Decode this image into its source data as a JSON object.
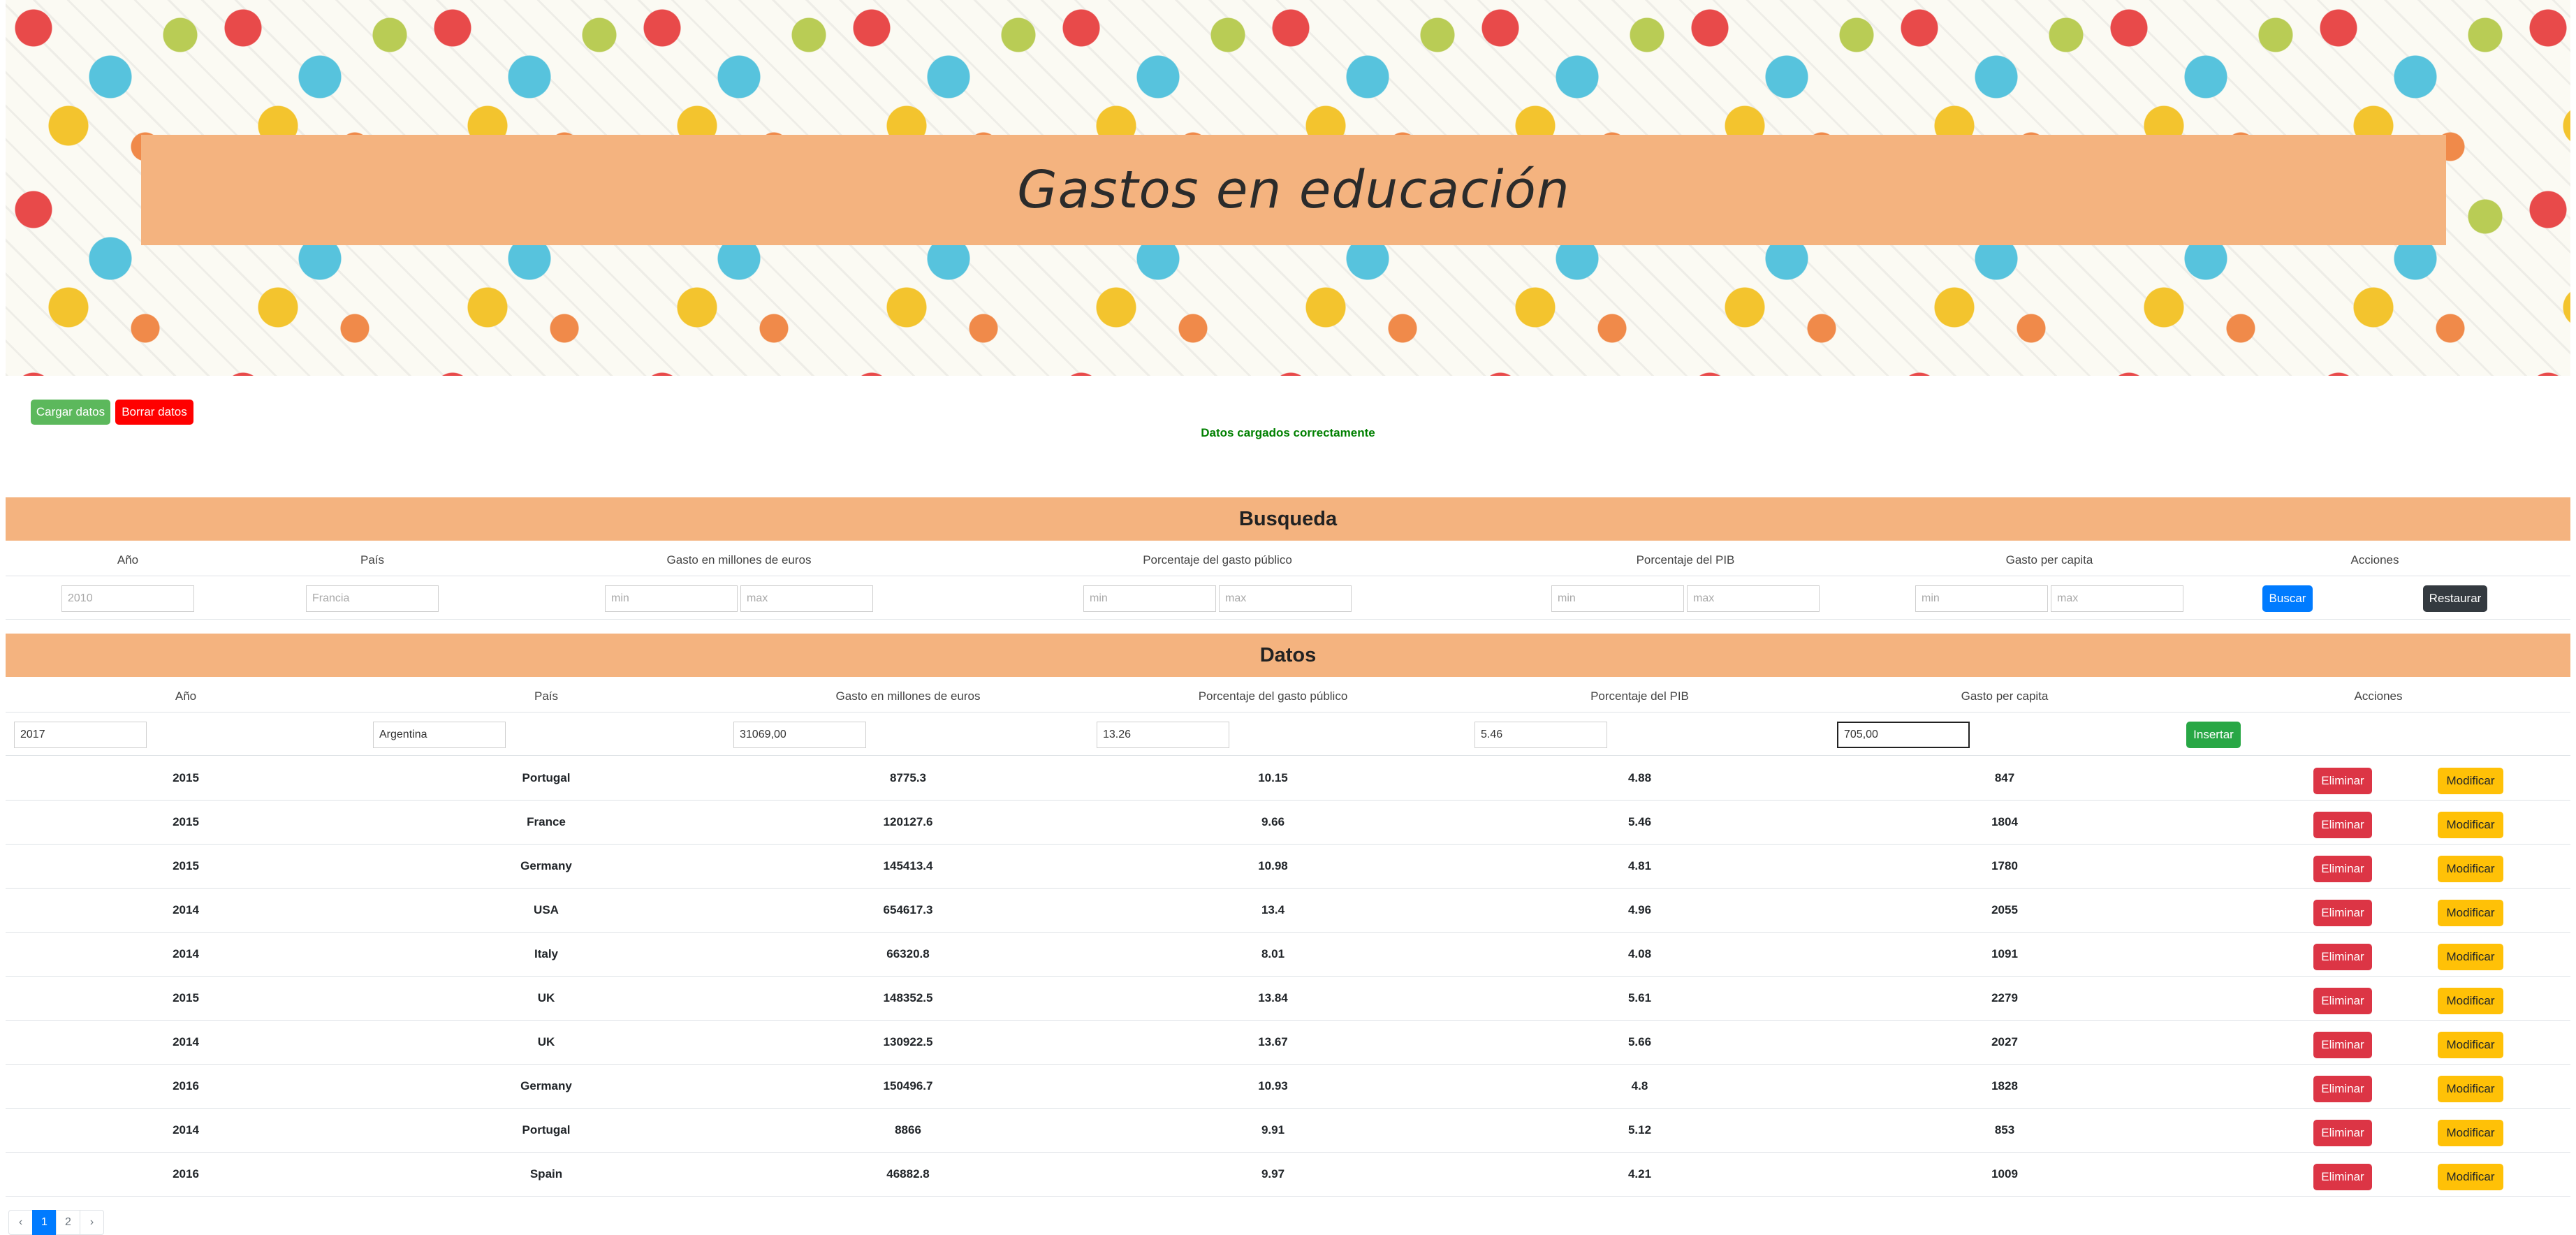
{
  "header": {
    "title": "Gastos en educación"
  },
  "actions": {
    "load_label": "Cargar datos",
    "clear_label": "Borrar datos"
  },
  "status": {
    "message": "Datos cargados correctamente"
  },
  "search": {
    "title": "Busqueda",
    "columns": [
      "Año",
      "País",
      "Gasto en millones de euros",
      "Porcentaje del gasto público",
      "Porcentaje del PIB",
      "Gasto per capita",
      "Acciones"
    ],
    "year_placeholder": "2010",
    "country_placeholder": "Francia",
    "min_placeholder": "min",
    "max_placeholder": "max",
    "search_label": "Buscar",
    "reset_label": "Restaurar"
  },
  "data_section": {
    "title": "Datos",
    "columns": [
      "Año",
      "País",
      "Gasto en millones de euros",
      "Porcentaje del gasto público",
      "Porcentaje del PIB",
      "Gasto per capita",
      "Acciones"
    ],
    "new_row": {
      "year": "2017",
      "country": "Argentina",
      "spending": "31069,00",
      "public_pct": "13.26",
      "gdp_pct": "5.46",
      "per_capita": "705,00"
    },
    "insert_label": "Insertar",
    "delete_label": "Eliminar",
    "modify_label": "Modificar",
    "rows": [
      [
        "2015",
        "Portugal",
        "8775.3",
        "10.15",
        "4.88",
        "847"
      ],
      [
        "2015",
        "France",
        "120127.6",
        "9.66",
        "5.46",
        "1804"
      ],
      [
        "2015",
        "Germany",
        "145413.4",
        "10.98",
        "4.81",
        "1780"
      ],
      [
        "2014",
        "USA",
        "654617.3",
        "13.4",
        "4.96",
        "2055"
      ],
      [
        "2014",
        "Italy",
        "66320.8",
        "8.01",
        "4.08",
        "1091"
      ],
      [
        "2015",
        "UK",
        "148352.5",
        "13.84",
        "5.61",
        "2279"
      ],
      [
        "2014",
        "UK",
        "130922.5",
        "13.67",
        "5.66",
        "2027"
      ],
      [
        "2016",
        "Germany",
        "150496.7",
        "10.93",
        "4.8",
        "1828"
      ],
      [
        "2014",
        "Portugal",
        "8866",
        "9.91",
        "5.12",
        "853"
      ],
      [
        "2016",
        "Spain",
        "46882.8",
        "9.97",
        "4.21",
        "1009"
      ]
    ]
  },
  "pagination": {
    "prev": "‹",
    "pages": [
      "1",
      "2"
    ],
    "next": "›",
    "active_page": "1"
  }
}
